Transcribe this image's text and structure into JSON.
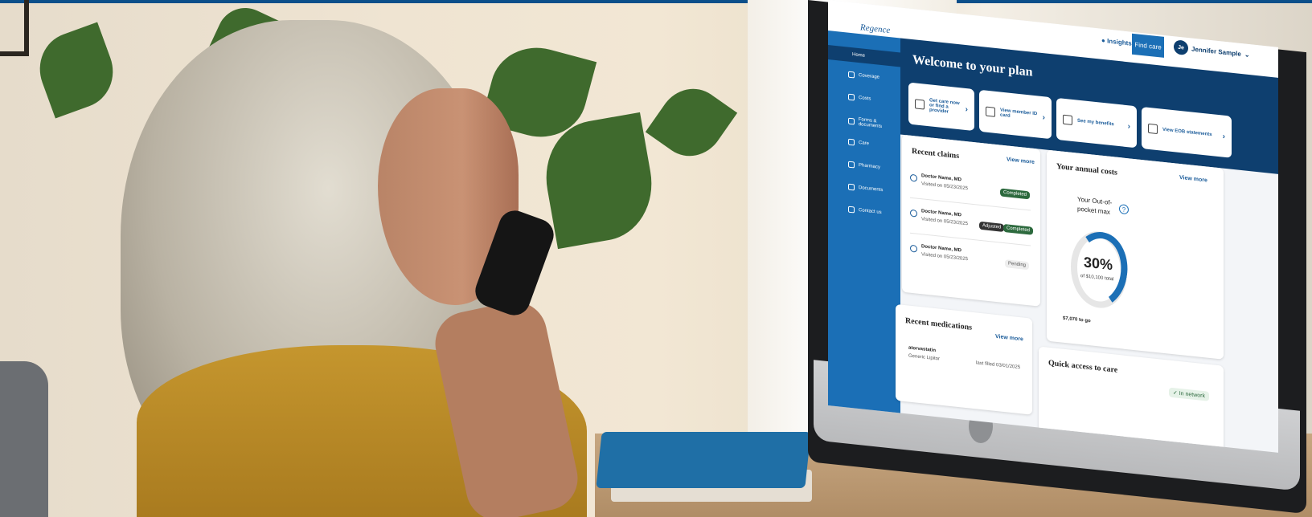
{
  "header": {
    "logo": "Regence",
    "insights_label": "Insights",
    "insights_count": "2",
    "find_care": "Find care",
    "user_initials": "Je",
    "user_name": "Jennifer Sample"
  },
  "sidebar": {
    "items": [
      {
        "label": "Home"
      },
      {
        "label": "Coverage"
      },
      {
        "label": "Costs"
      },
      {
        "label": "Forms & documents"
      },
      {
        "label": "Care"
      },
      {
        "label": "Pharmacy"
      },
      {
        "label": "Documents"
      },
      {
        "label": "Contact us"
      }
    ]
  },
  "main": {
    "welcome": "Welcome to your plan",
    "quick_links": [
      {
        "label": "Get care now or find a provider"
      },
      {
        "label": "View member ID card"
      },
      {
        "label": "See my benefits"
      },
      {
        "label": "View EOB statements"
      }
    ],
    "recent_claims": {
      "title": "Recent claims",
      "view_more": "View more",
      "claims": [
        {
          "doctor": "Doctor Name, MD",
          "visited": "Visited on 05/23/2025",
          "status": [
            "Completed"
          ]
        },
        {
          "doctor": "Doctor Name, MD",
          "visited": "Visited on 05/23/2025",
          "status": [
            "Adjusted",
            "Completed"
          ]
        },
        {
          "doctor": "Doctor Name, MD",
          "visited": "Visited on 05/23/2025",
          "status": [
            "Pending"
          ]
        }
      ]
    },
    "annual_costs": {
      "title": "Your annual costs",
      "view_more": "View more",
      "label": "Your Out-of-pocket max",
      "help": "?",
      "percent_text": "30%",
      "percent": 30,
      "of_total": "of $10,100 total",
      "to_go": "$7,070 to go"
    },
    "recent_medications": {
      "title": "Recent medications",
      "view_more": "View more",
      "name": "atorvastatin",
      "generic": "Generic Lipitor",
      "filled": "last filled 03/01/2025"
    },
    "quick_access": {
      "title": "Quick access to care",
      "badge": "In network"
    }
  },
  "colors": {
    "brand_dark": "#0e3f6f",
    "brand": "#1b6fb6",
    "success": "#2d6a3e",
    "top_bar": "#0b4f8a"
  }
}
